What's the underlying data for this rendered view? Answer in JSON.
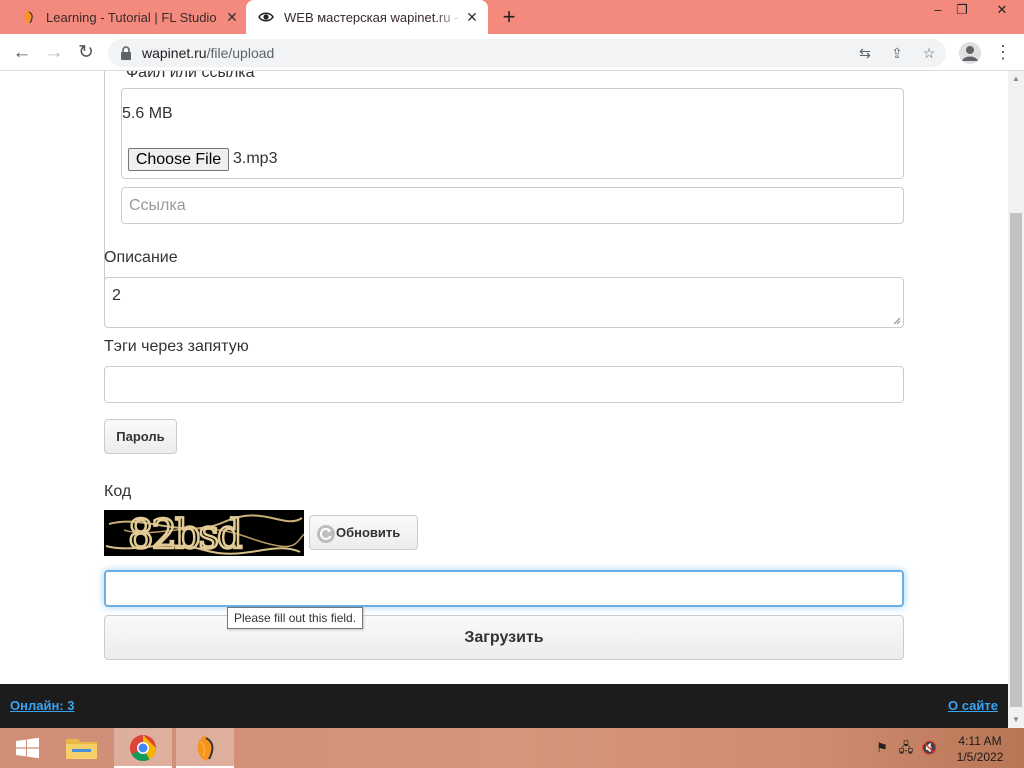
{
  "browser": {
    "tabs": [
      {
        "title": "Learning - Tutorial | FL Studio"
      },
      {
        "title": "WEB мастерская wapinet.ru - За"
      }
    ],
    "new_tab": "+",
    "url_host": "wapinet.ru",
    "url_path": "/file/upload",
    "window_controls": {
      "minimize": "–",
      "restore": "❐",
      "close": "✕"
    }
  },
  "form": {
    "fieldset_legend": "Файл или ссылка",
    "file_size": "5.6 MB",
    "choose_file_label": "Choose File",
    "chosen_file": "3.mp3",
    "link_placeholder": "Ссылка",
    "description_label": "Описание",
    "description_value": "2",
    "tags_label": "Тэги через запятую",
    "tags_value": "",
    "password_button": "Пароль",
    "code_label": "Код",
    "captcha_text": "82bsd",
    "refresh_button": "Обновить",
    "code_value": "",
    "validation_tooltip": "Please fill out this field.",
    "submit_button": "Загрузить"
  },
  "footer": {
    "online": "Онлайн: 3",
    "about": "О сайте"
  },
  "taskbar": {
    "time": "4:11 AM",
    "date": "1/5/2022"
  },
  "colors": {
    "tabstrip": "#f48a7e",
    "link": "#3aa3f0",
    "focus": "#66afe9",
    "footer": "#1c1c1c"
  }
}
